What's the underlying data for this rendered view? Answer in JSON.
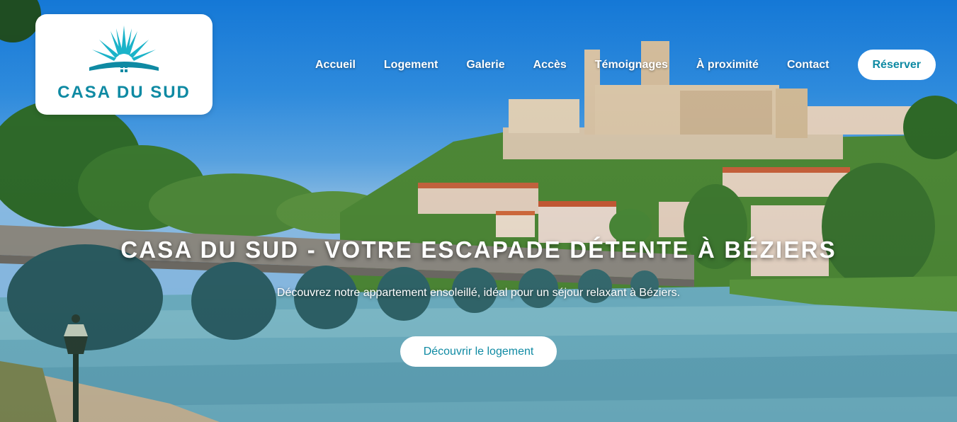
{
  "brand": {
    "name": "CASA DU SUD",
    "logo_icon": "sun-house-icon",
    "accent_color": "#0f8aa3"
  },
  "nav": {
    "items": [
      "Accueil",
      "Logement",
      "Galerie",
      "Accès",
      "Témoignages",
      "À proximité",
      "Contact"
    ],
    "cta_label": "Réserver"
  },
  "hero": {
    "title": "CASA DU SUD - VOTRE ESCAPADE DÉTENTE À BÉZIERS",
    "subtitle": "Découvrez notre appartement ensoleillé, idéal pour un séjour relaxant à Béziers.",
    "cta_label": "Découvrir le logement",
    "background_image": "hero-background-image"
  }
}
